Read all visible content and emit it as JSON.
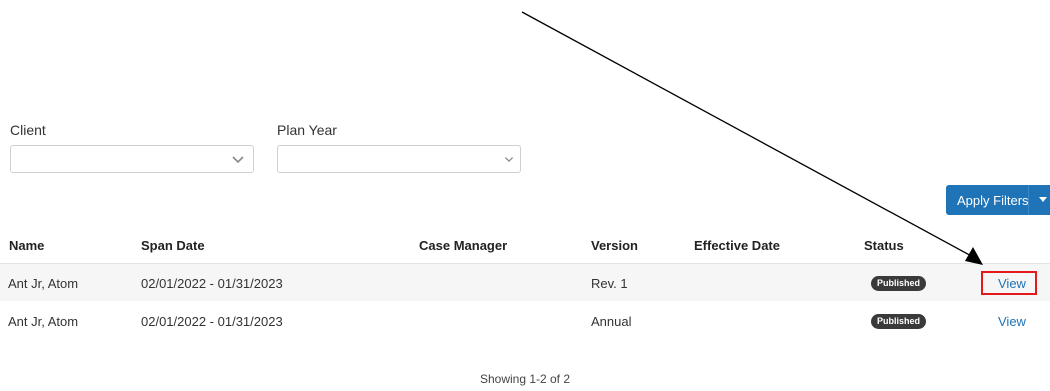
{
  "filters": {
    "client_label": "Client",
    "client_value": "",
    "plan_year_label": "Plan Year",
    "plan_year_value": ""
  },
  "actions": {
    "apply_filters_label": "Apply Filters"
  },
  "table": {
    "columns": [
      "Name",
      "Span Date",
      "Case Manager",
      "Version",
      "Effective Date",
      "Status"
    ],
    "rows": [
      {
        "name": "Ant Jr, Atom",
        "span_date": "02/01/2022 - 01/31/2023",
        "case_manager": "",
        "version": "Rev. 1",
        "effective_date": "",
        "status": "Published",
        "action": "View"
      },
      {
        "name": "Ant Jr, Atom",
        "span_date": "02/01/2022 - 01/31/2023",
        "case_manager": "",
        "version": "Annual",
        "effective_date": "",
        "status": "Published",
        "action": "View"
      }
    ]
  },
  "pagination": {
    "summary": "Showing 1-2 of 2"
  },
  "annotation": {
    "highlight_color": "#e3191c",
    "arrow_color": "#000000"
  },
  "colors": {
    "accent": "#1f73b7",
    "badge_bg": "#3a3a3a"
  }
}
